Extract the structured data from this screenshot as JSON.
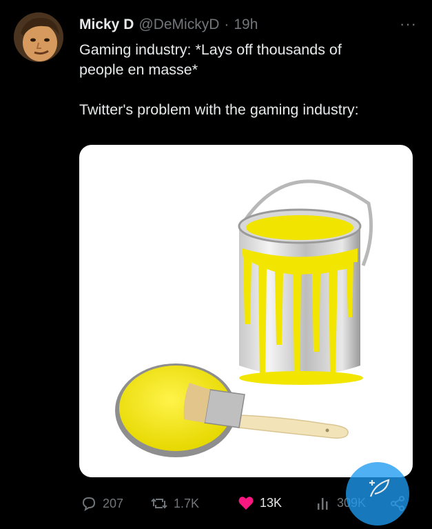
{
  "tweet": {
    "display_name": "Micky D",
    "handle": "@DeMickyD",
    "separator": "·",
    "time": "19h",
    "more": "···",
    "lines": [
      "Gaming industry: *Lays off thousands of",
      "people en masse*",
      "Twitter's problem with the gaming industry:"
    ]
  },
  "actions": {
    "replies": "207",
    "reposts": "1.7K",
    "likes": "13K",
    "views": "309K"
  },
  "colors": {
    "background": "#000000",
    "text": "#e7e9ea",
    "muted": "#71767b",
    "like": "#f91880",
    "accent": "#1d9bf0",
    "paint": "#f2e600"
  },
  "icons": [
    "reply-icon",
    "repost-icon",
    "heart-icon",
    "views-icon",
    "share-icon",
    "compose-icon"
  ]
}
